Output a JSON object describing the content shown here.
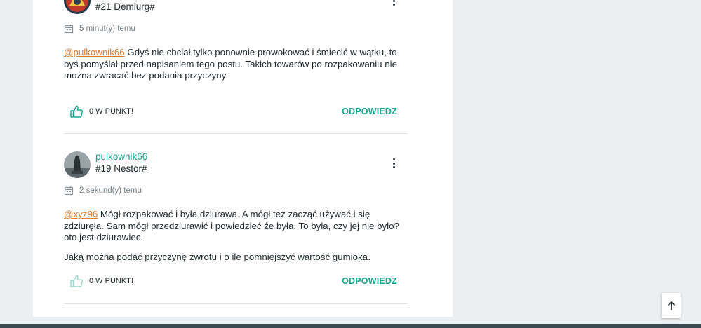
{
  "posts": [
    {
      "author": "",
      "rank": "#21 Demiurg#",
      "time": "5 minut(y) temu",
      "paragraphs": [
        {
          "mention": "@pulkownik66",
          "text": " Gdyś nie chciał tylko ponownie prowokować i śmiecić w wątku, to byś pomyślał przed napisaniem tego postu. Takich towarów po rozpakowaniu nie można zwracać bez podania przyczyny."
        }
      ],
      "likes": "0 W PUNKT!",
      "reply": "ODPOWIEDZ"
    },
    {
      "author": "pulkownik66",
      "rank": "#19 Nestor#",
      "time": "2 sekund(y) temu",
      "paragraphs": [
        {
          "mention": "@xyz96",
          "text": "  Mógł rozpakować i była dziurawa. A mógł też zacząć używać i się zdziuręła. Sam mógł przedziurawić i powiedzieć że była. To była, czy jej nie było? oto jest dziurawiec."
        },
        {
          "text": "Jaką można podać przyczynę zwrotu i o ile pomniejszyć wartość gumioka."
        }
      ],
      "likes": "0 W PUNKT!",
      "reply": "ODPOWIEDZ"
    }
  ],
  "colors": {
    "accent": "#17a58f",
    "mention": "#e57a2d",
    "background": "#eceff1"
  },
  "icons": {
    "like": "thumbs-up-icon",
    "time": "calendar-icon",
    "menu": "kebab-menu-icon",
    "scroll": "arrow-up-icon"
  }
}
